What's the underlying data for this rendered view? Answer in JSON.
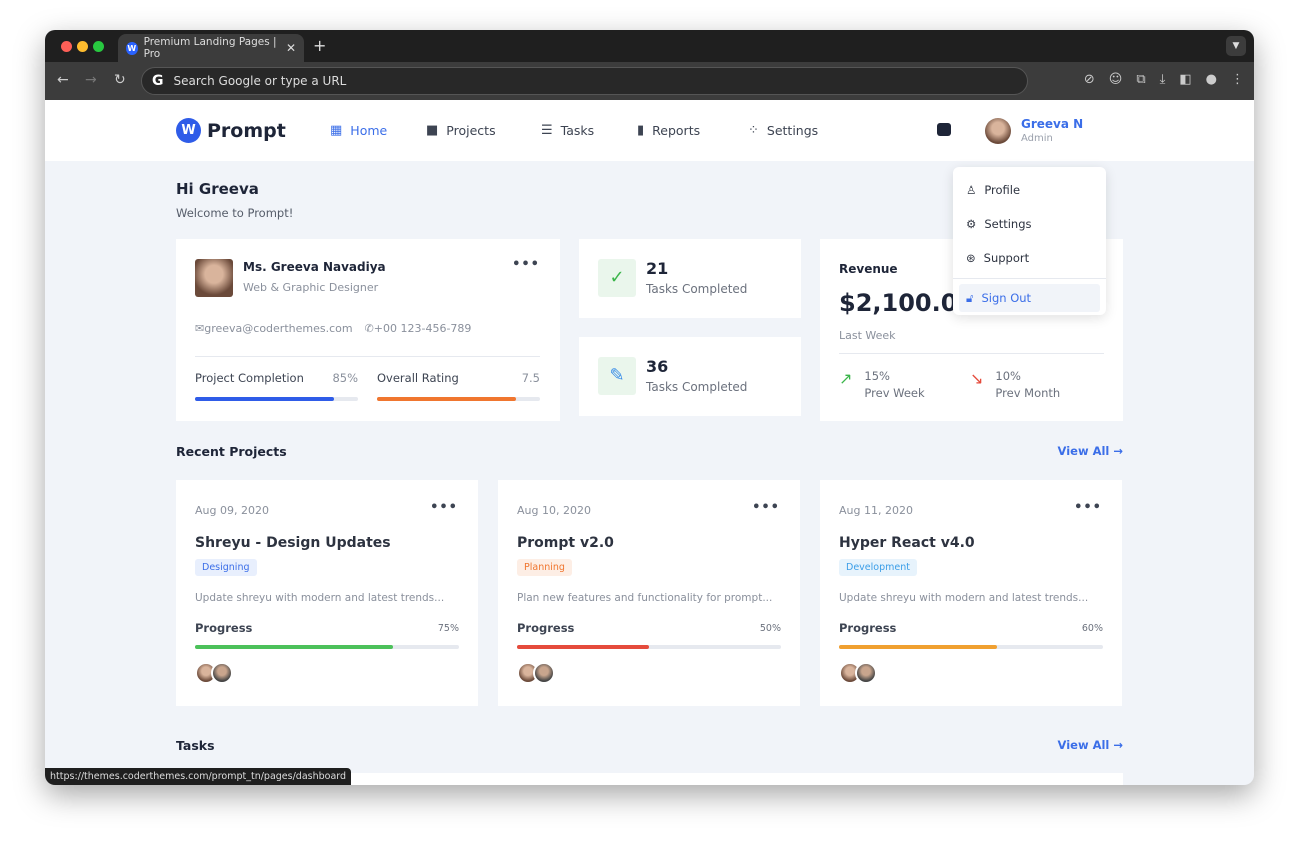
{
  "browser": {
    "tab_title": "Premium Landing Pages | Pro",
    "omnibox_placeholder": "Search Google or type a URL",
    "status_url": "https://themes.coderthemes.com/prompt_tn/pages/dashboard"
  },
  "nav": {
    "brand": "Prompt",
    "items": [
      {
        "label": "Home",
        "icon": "grid-icon",
        "active": true
      },
      {
        "label": "Projects",
        "icon": "folder-icon"
      },
      {
        "label": "Tasks",
        "icon": "list-icon"
      },
      {
        "label": "Reports",
        "icon": "bar-chart-icon"
      },
      {
        "label": "Settings",
        "icon": "toggle-icon"
      }
    ],
    "user": {
      "name": "Greeva N",
      "role": "Admin"
    }
  },
  "dropdown": {
    "items": [
      {
        "label": "Profile",
        "icon": "user-icon"
      },
      {
        "label": "Settings",
        "icon": "gear-icon"
      },
      {
        "label": "Support",
        "icon": "lifebuoy-icon"
      },
      {
        "label": "Sign Out",
        "icon": "unlock-icon"
      }
    ]
  },
  "greeting": {
    "title": "Hi Greeva",
    "subtitle": "Welcome to Prompt!"
  },
  "profile": {
    "name": "Ms. Greeva Navadiya",
    "title": "Web & Graphic Designer",
    "email": "greeva@coderthemes.com",
    "phone": "+00 123-456-789",
    "completion_label": "Project Completion",
    "completion_value": "85%",
    "completion_pct": 85,
    "rating_label": "Overall Rating",
    "rating_value": "7.5",
    "rating_pct": 85
  },
  "stats": [
    {
      "value": "21",
      "label": "Tasks Completed",
      "icon": "check-circle-icon",
      "color": "#3bb54a"
    },
    {
      "value": "36",
      "label": "Tasks Completed",
      "icon": "pencil-icon",
      "color": "#3b8ee8"
    }
  ],
  "revenue": {
    "title": "Revenue",
    "amount": "$2,100.00",
    "period": "Last Week",
    "up_value": "15%",
    "up_label": "Prev Week",
    "down_value": "10%",
    "down_label": "Prev Month"
  },
  "recent": {
    "title": "Recent Projects",
    "view_all": "View All",
    "projects": [
      {
        "date": "Aug 09, 2020",
        "name": "Shreyu - Design Updates",
        "tag": "Designing",
        "tag_color": "#3b6ee8",
        "tag_bg": "#e8effd",
        "desc": "Update shreyu with modern and latest trends...",
        "progress_label": "Progress",
        "progress": "75%",
        "pct": 75,
        "color": "#4cc15a"
      },
      {
        "date": "Aug 10, 2020",
        "name": "Prompt v2.0",
        "tag": "Planning",
        "tag_color": "#f0762f",
        "tag_bg": "#fdeee5",
        "desc": "Plan new features and functionality for prompt...",
        "progress_label": "Progress",
        "progress": "50%",
        "pct": 50,
        "color": "#e54b3c"
      },
      {
        "date": "Aug 11, 2020",
        "name": "Hyper React v4.0",
        "tag": "Development",
        "tag_color": "#3b9ee8",
        "tag_bg": "#e7f3fc",
        "desc": "Update shreyu with modern and latest trends...",
        "progress_label": "Progress",
        "progress": "60%",
        "pct": 60,
        "color": "#f0a030"
      }
    ]
  },
  "tasks": {
    "title": "Tasks",
    "view_all": "View All"
  }
}
